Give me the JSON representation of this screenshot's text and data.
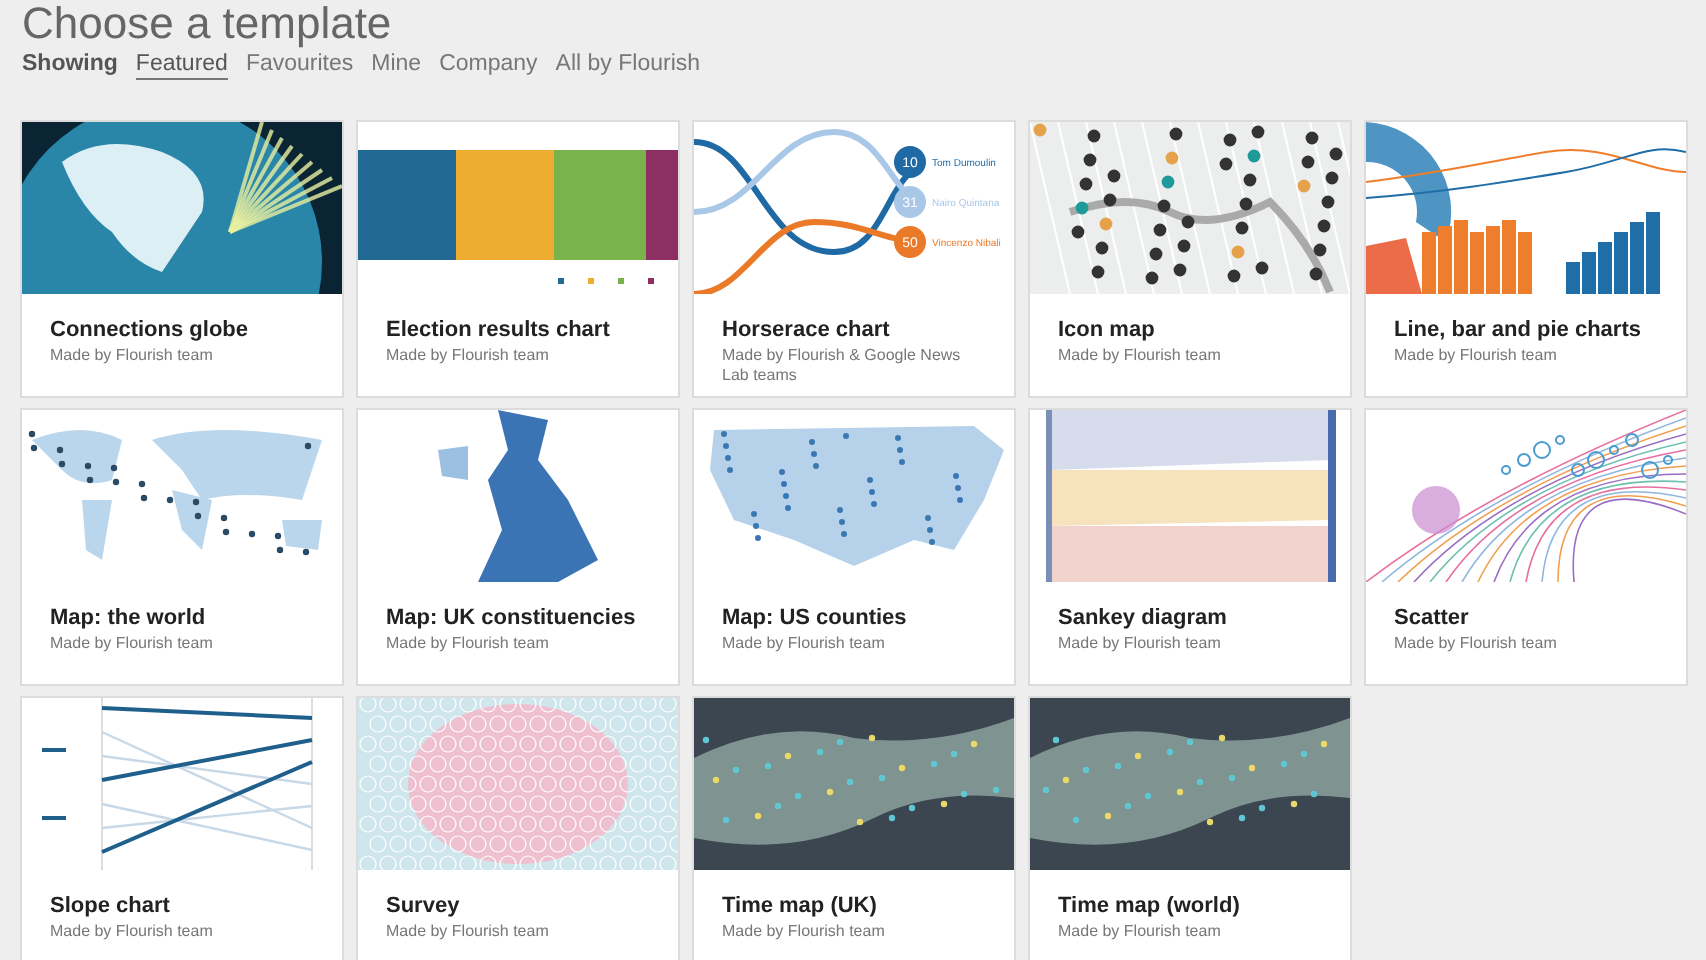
{
  "page_title": "Choose a template",
  "filter": {
    "label": "Showing",
    "tabs": [
      {
        "label": "Featured",
        "selected": true
      },
      {
        "label": "Favourites",
        "selected": false
      },
      {
        "label": "Mine",
        "selected": false
      },
      {
        "label": "Company",
        "selected": false
      },
      {
        "label": "All by Flourish",
        "selected": false
      }
    ]
  },
  "templates": [
    {
      "title": "Connections globe",
      "author": "Made by Flourish team",
      "kind": "globe"
    },
    {
      "title": "Election results chart",
      "author": "Made by Flourish team",
      "kind": "election"
    },
    {
      "title": "Horserace chart",
      "author": "Made by Flourish & Google News Lab teams",
      "kind": "horserace",
      "labels": [
        {
          "rank": "10",
          "name": "Tom Dumoulin"
        },
        {
          "rank": "31",
          "name": "Nairo Quintana"
        },
        {
          "rank": "50",
          "name": "Vincenzo Nibali"
        }
      ]
    },
    {
      "title": "Icon map",
      "author": "Made by Flourish team",
      "kind": "iconmap"
    },
    {
      "title": "Line, bar and pie charts",
      "author": "Made by Flourish team",
      "kind": "linebarpie"
    },
    {
      "title": "Map: the world",
      "author": "Made by Flourish team",
      "kind": "worldmap"
    },
    {
      "title": "Map: UK constituencies",
      "author": "Made by Flourish team",
      "kind": "ukmap"
    },
    {
      "title": "Map: US counties",
      "author": "Made by Flourish team",
      "kind": "usmap"
    },
    {
      "title": "Sankey diagram",
      "author": "Made by Flourish team",
      "kind": "sankey"
    },
    {
      "title": "Scatter",
      "author": "Made by Flourish team",
      "kind": "scatter"
    },
    {
      "title": "Slope chart",
      "author": "Made by Flourish team",
      "kind": "slope"
    },
    {
      "title": "Survey",
      "author": "Made by Flourish team",
      "kind": "survey"
    },
    {
      "title": "Time map (UK)",
      "author": "Made by Flourish team",
      "kind": "timemap"
    },
    {
      "title": "Time map (world)",
      "author": "Made by Flourish team",
      "kind": "timemap"
    }
  ]
}
